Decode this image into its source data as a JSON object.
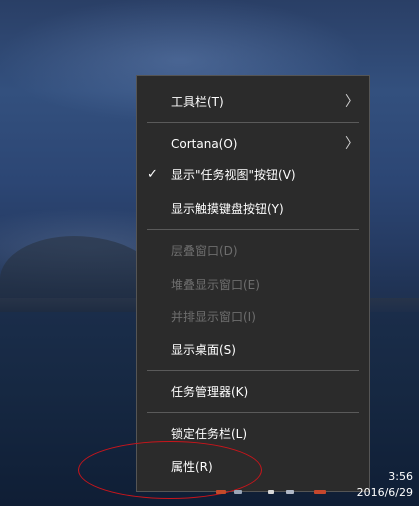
{
  "context_menu": {
    "items": [
      {
        "label": "工具栏(T)",
        "has_submenu": true,
        "checked": false,
        "disabled": false
      },
      {
        "label": "Cortana(O)",
        "has_submenu": true,
        "checked": false,
        "disabled": false
      },
      {
        "label": "显示\"任务视图\"按钮(V)",
        "has_submenu": false,
        "checked": true,
        "disabled": false
      },
      {
        "label": "显示触摸键盘按钮(Y)",
        "has_submenu": false,
        "checked": false,
        "disabled": false
      },
      {
        "label": "层叠窗口(D)",
        "has_submenu": false,
        "checked": false,
        "disabled": true
      },
      {
        "label": "堆叠显示窗口(E)",
        "has_submenu": false,
        "checked": false,
        "disabled": true
      },
      {
        "label": "并排显示窗口(I)",
        "has_submenu": false,
        "checked": false,
        "disabled": true
      },
      {
        "label": "显示桌面(S)",
        "has_submenu": false,
        "checked": false,
        "disabled": false
      },
      {
        "label": "任务管理器(K)",
        "has_submenu": false,
        "checked": false,
        "disabled": false
      },
      {
        "label": "锁定任务栏(L)",
        "has_submenu": false,
        "checked": false,
        "disabled": false
      },
      {
        "label": "属性(R)",
        "has_submenu": false,
        "checked": false,
        "disabled": false
      }
    ],
    "check_glyph": "✓",
    "submenu_glyph": "〉"
  },
  "taskbar": {
    "time": "3:56",
    "date": "2016/6/29"
  },
  "colors": {
    "menu_background": "#2b2b2b",
    "menu_text": "#ffffff",
    "menu_disabled_text": "#6e6e6e",
    "annotation_circle": "#c8151b"
  }
}
